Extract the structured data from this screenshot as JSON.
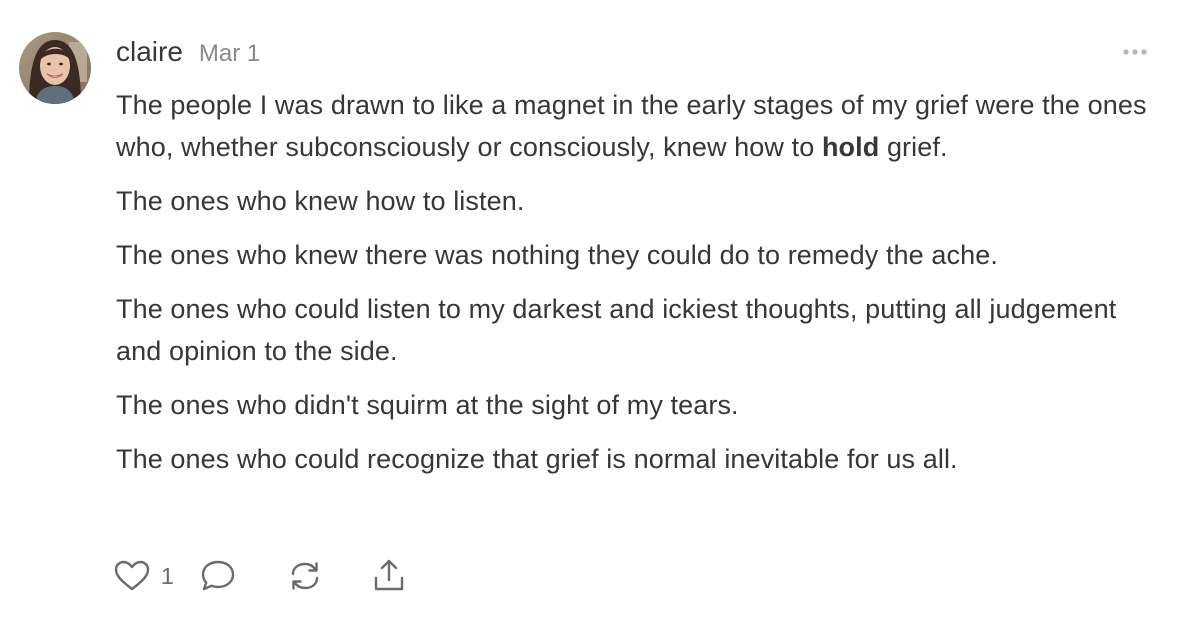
{
  "comment": {
    "author": "claire",
    "date": "Mar 1",
    "avatar_icon": "user-avatar-photo",
    "paragraphs": [
      {
        "before": "The people I was drawn to like a magnet in the early stages of my grief were the ones who, whether subconsciously or consciously, knew how to ",
        "bold": "hold",
        "after": " grief."
      },
      "The ones who knew how to listen.",
      "The ones who knew there was nothing they could do to remedy the ache.",
      "The ones who could listen to my darkest and ickiest thoughts, putting all judgement and opinion to the side.",
      "The ones who didn't squirm at the sight of my tears.",
      "The ones who could recognize that grief is normal inevitable for us all."
    ],
    "actions": {
      "like_icon": "heart-icon",
      "like_count": "1",
      "comment_icon": "speech-bubble-icon",
      "restack_icon": "restack-icon",
      "share_icon": "share-icon",
      "more_icon": "ellipsis-icon"
    }
  },
  "colors": {
    "text": "#363737",
    "muted": "#8a8a8a",
    "icon": "#6b6b6b"
  }
}
